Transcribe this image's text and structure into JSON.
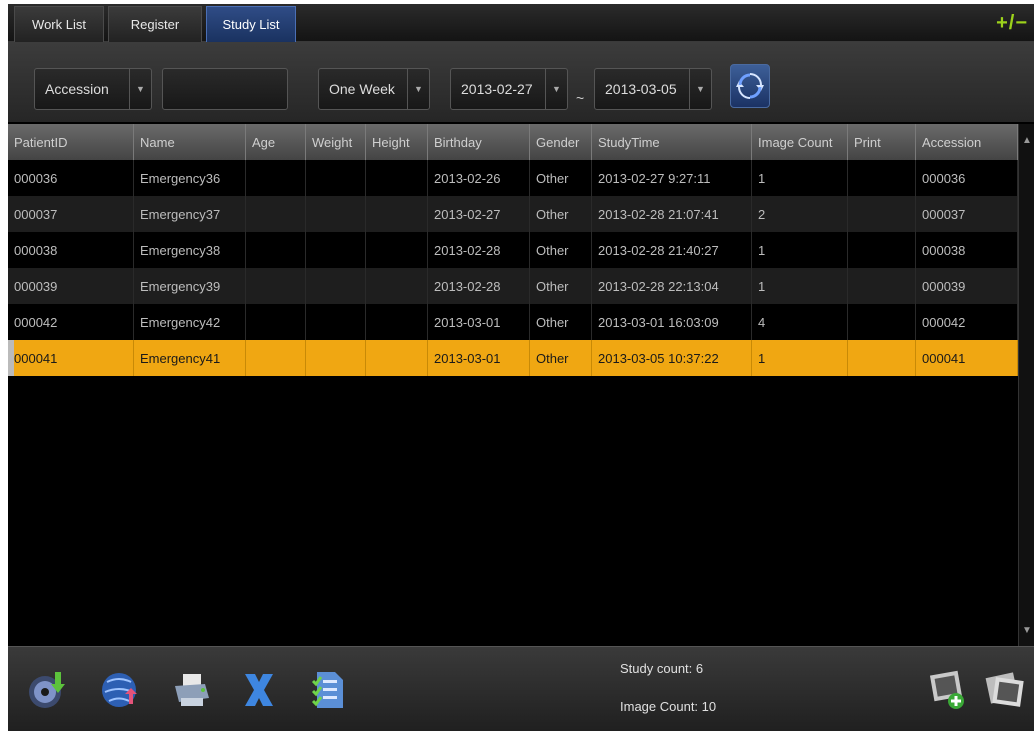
{
  "tabs": [
    {
      "label": "Work List",
      "active": false
    },
    {
      "label": "Register",
      "active": false
    },
    {
      "label": "Study List",
      "active": true
    }
  ],
  "toggle_label": "+/−",
  "filters": {
    "field_select": "Accession",
    "search_value": "",
    "range_select": "One Week",
    "date_from": "2013-02-27",
    "separator": "~",
    "date_to": "2013-03-05"
  },
  "table": {
    "columns": [
      "PatientID",
      "Name",
      "Age",
      "Weight",
      "Height",
      "Birthday",
      "Gender",
      "StudyTime",
      "Image Count",
      "Print",
      "Accession"
    ],
    "rows": [
      [
        "000036",
        "Emergency36",
        "",
        "",
        "",
        "2013-02-26",
        "Other",
        "2013-02-27 9:27:11",
        "1",
        "",
        "000036"
      ],
      [
        "000037",
        "Emergency37",
        "",
        "",
        "",
        "2013-02-27",
        "Other",
        "2013-02-28 21:07:41",
        "2",
        "",
        "000037"
      ],
      [
        "000038",
        "Emergency38",
        "",
        "",
        "",
        "2013-02-28",
        "Other",
        "2013-02-28 21:40:27",
        "1",
        "",
        "000038"
      ],
      [
        "000039",
        "Emergency39",
        "",
        "",
        "",
        "2013-02-28",
        "Other",
        "2013-02-28 22:13:04",
        "1",
        "",
        "000039"
      ],
      [
        "000042",
        "Emergency42",
        "",
        "",
        "",
        "2013-03-01",
        "Other",
        "2013-03-01 16:03:09",
        "4",
        "",
        "000042"
      ],
      [
        "000041",
        "Emergency41",
        "",
        "",
        "",
        "2013-03-01",
        "Other",
        "2013-03-05 10:37:22",
        "1",
        "",
        "000041"
      ]
    ],
    "selected_row": 5
  },
  "stats": {
    "study_count": "Study count: 6",
    "image_count": "Image Count: 10"
  },
  "colors": {
    "selected_row": "#f0a712",
    "active_tab": "#2f4c86",
    "toggle": "#9cd21b"
  },
  "toolbar_icons": [
    "import-icon",
    "send-network-icon",
    "print-icon",
    "delete-icon",
    "report-icon"
  ],
  "right_icons": [
    "add-image-icon",
    "view-image-icon"
  ]
}
